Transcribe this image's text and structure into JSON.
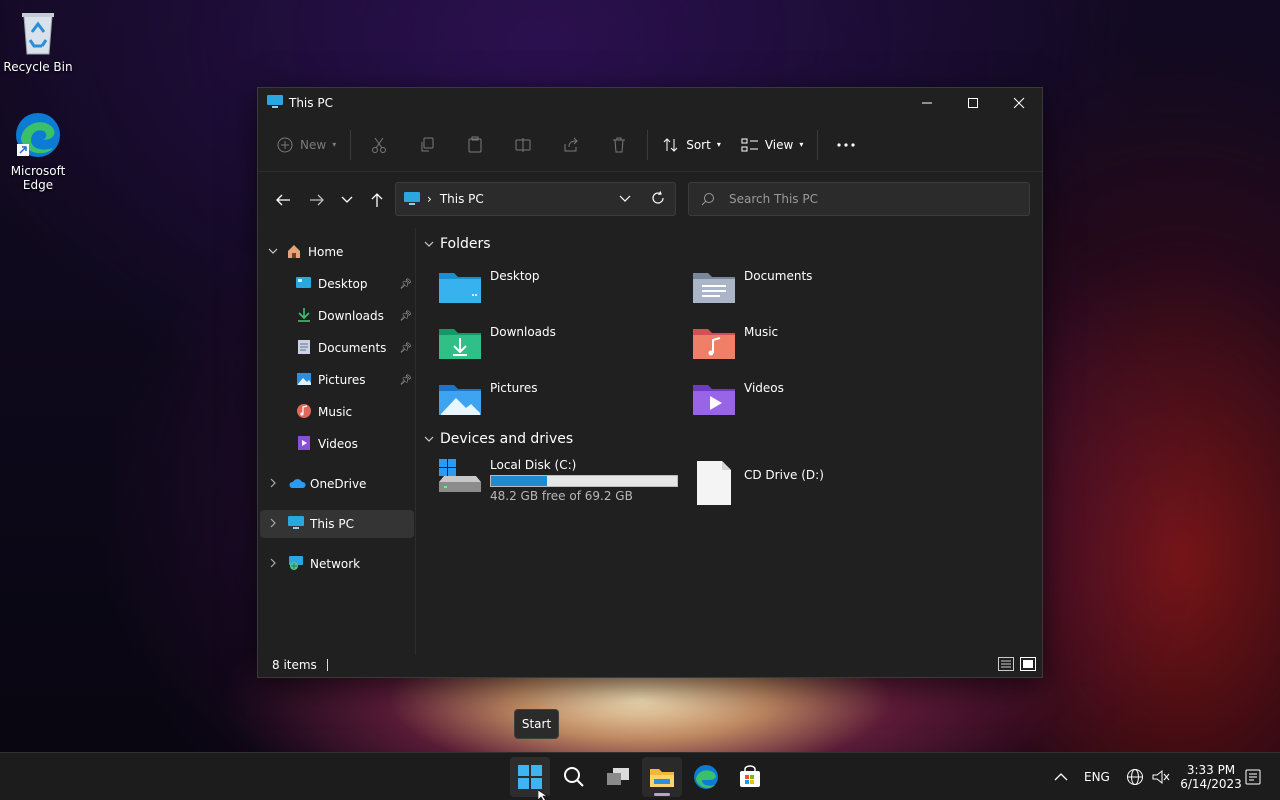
{
  "desktop": {
    "icons": [
      {
        "label": "Recycle Bin",
        "icon": "recycle-bin-icon"
      },
      {
        "label": "Microsoft Edge",
        "label_line1": "Microsoft",
        "label_line2": "Edge",
        "icon": "edge-icon"
      }
    ]
  },
  "window": {
    "title": "This PC",
    "toolbar": {
      "new_label": "New",
      "sort_label": "Sort",
      "view_label": "View"
    },
    "address": {
      "path": "This PC"
    },
    "search": {
      "placeholder": "Search This PC"
    },
    "sidebar": {
      "home": "Home",
      "items": [
        {
          "label": "Desktop",
          "pinned": true
        },
        {
          "label": "Downloads",
          "pinned": true
        },
        {
          "label": "Documents",
          "pinned": true
        },
        {
          "label": "Pictures",
          "pinned": true
        },
        {
          "label": "Music",
          "pinned": false
        },
        {
          "label": "Videos",
          "pinned": false
        }
      ],
      "onedrive": "OneDrive",
      "thispc": "This PC",
      "network": "Network"
    },
    "content": {
      "folders_header": "Folders",
      "folders": [
        "Desktop",
        "Documents",
        "Downloads",
        "Music",
        "Pictures",
        "Videos"
      ],
      "drives_header": "Devices and drives",
      "drives": [
        {
          "name": "Local Disk (C:)",
          "info": "48.2 GB free of 69.2 GB",
          "used_fraction": 0.3
        },
        {
          "name": "CD Drive (D:)"
        }
      ]
    },
    "status": {
      "items": "8 items"
    }
  },
  "tooltip": "Start",
  "taskbar": {
    "apps": [
      "start-icon",
      "search-icon",
      "task-view-icon",
      "file-explorer-icon",
      "edge-icon",
      "store-icon"
    ],
    "language": "ENG",
    "time": "3:33 PM",
    "date": "6/14/2023"
  },
  "colors": {
    "accent": "#1f8ad2",
    "window_bg": "#202020",
    "taskbar_bg": "#1c1c1c"
  }
}
